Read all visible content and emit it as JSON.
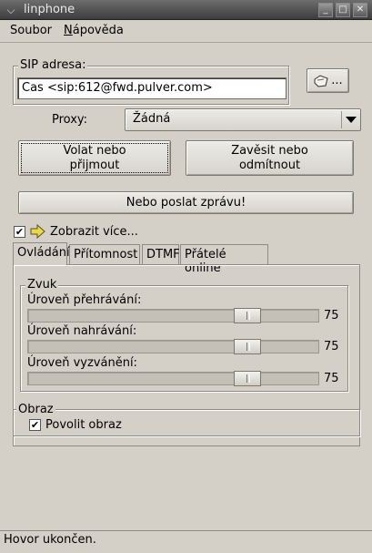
{
  "window": {
    "title": "linphone",
    "controls": [
      "minimize-icon",
      "maximize-icon",
      "close-icon"
    ]
  },
  "menubar": {
    "items": [
      {
        "label": "Soubor",
        "mnemonic": ""
      },
      {
        "label": "Nápověda",
        "mnemonic": "N"
      }
    ]
  },
  "sip": {
    "frame_label": "SIP adresa:",
    "address_value": "Cas <sip:612@fwd.pulver.com>",
    "addressbook_button_label": "..."
  },
  "proxy": {
    "label": "Proxy:",
    "selected": "Žádná"
  },
  "actions": {
    "call_label": "Volat nebo\npřijmout",
    "hangup_label": "Zavěsit nebo\nodmítnout",
    "message_label": "Nebo poslat zprávu!"
  },
  "more": {
    "label": "Zobrazit více...",
    "checked": true
  },
  "tabs": [
    {
      "label": "Ovládání",
      "active": true
    },
    {
      "label": "Přítomnost",
      "active": false
    },
    {
      "label": "DTMF",
      "active": false
    },
    {
      "label": "Přátelé online",
      "active": false
    }
  ],
  "sound": {
    "frame_label": "Zvuk",
    "sliders": [
      {
        "label": "Úroveň přehrávání:",
        "value": 75,
        "max": 100
      },
      {
        "label": "Úroveň nahrávání:",
        "value": 75,
        "max": 100
      },
      {
        "label": "Úroveň vyzvánění:",
        "value": 75,
        "max": 100
      }
    ]
  },
  "video": {
    "frame_label": "Obraz",
    "enable_label": "Povolit obraz",
    "checked": true
  },
  "status": {
    "text": "Hovor ukončen."
  }
}
